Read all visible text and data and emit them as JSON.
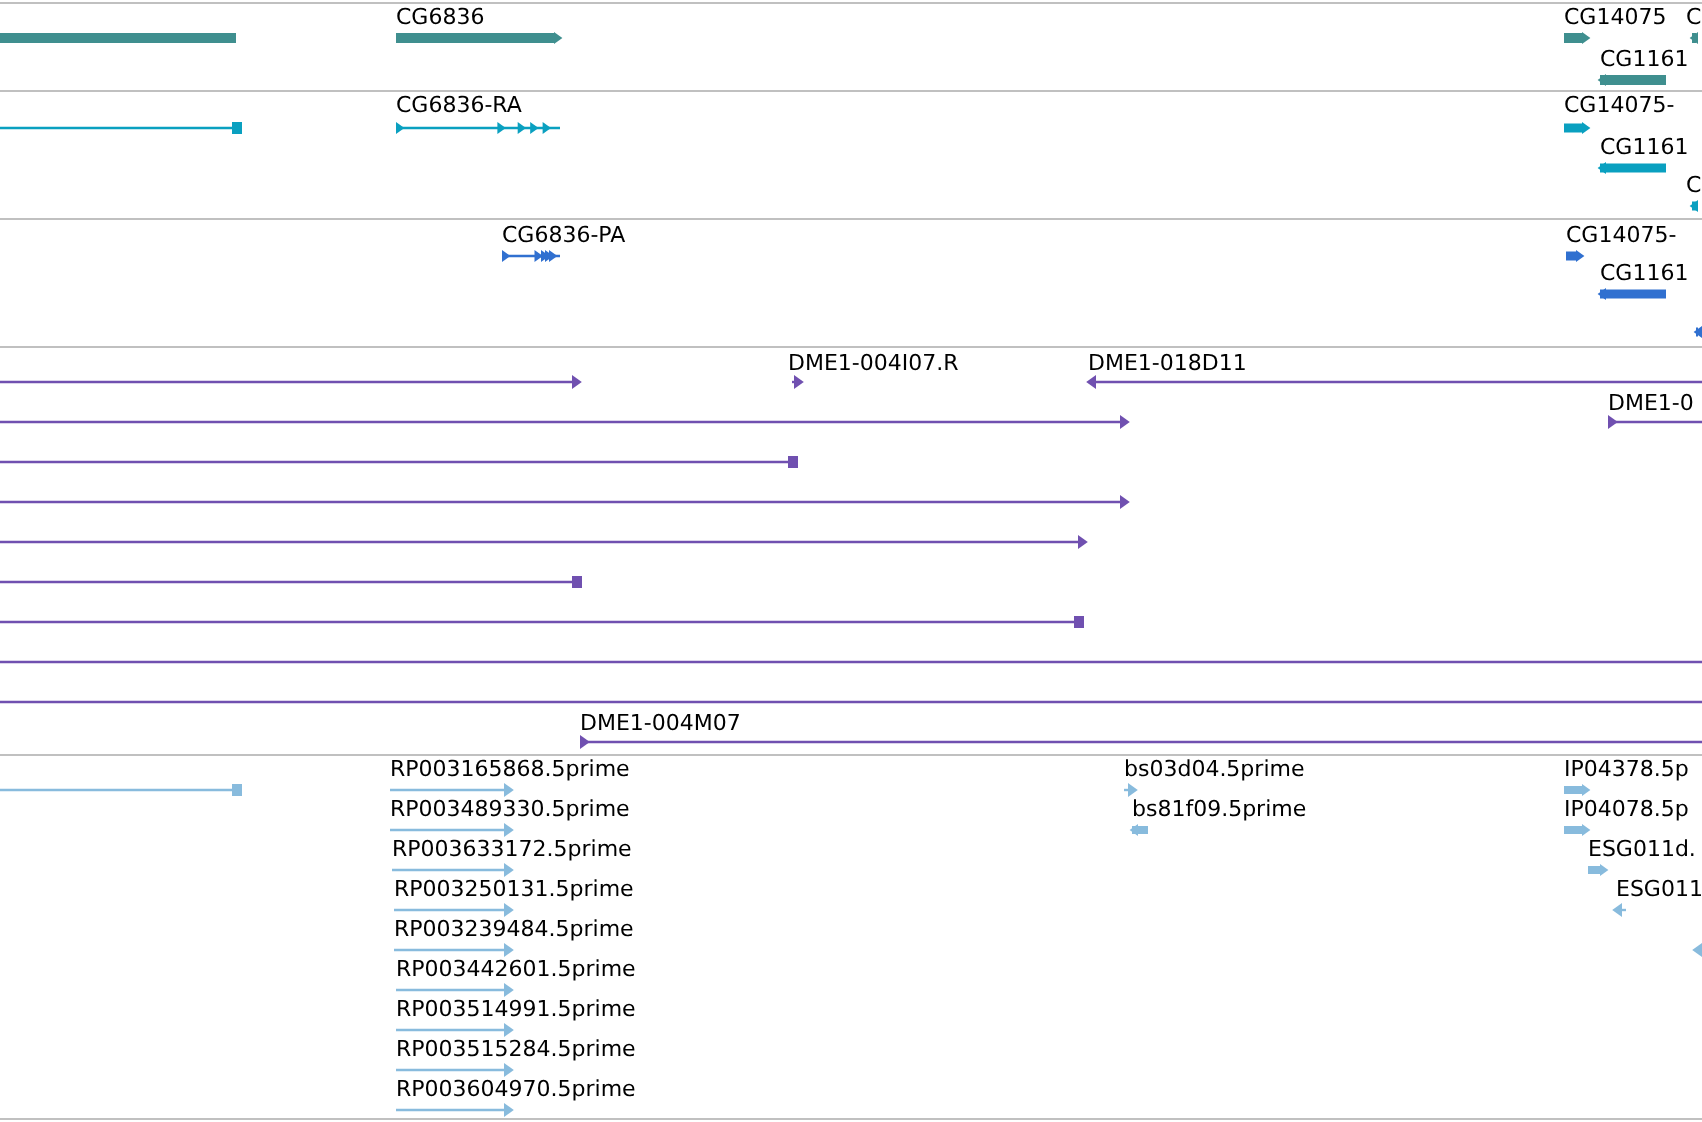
{
  "tracks": [
    {
      "kind": "gene",
      "color": "#3f8f8f",
      "features": [
        {
          "kind": "bar"
        },
        {
          "kind": "bar",
          "reverse": false,
          "label": "CG6836"
        },
        {
          "kind": "bar",
          "reverse": false,
          "label": "CG14075"
        },
        {
          "kind": "bar",
          "reverse": true,
          "label": "C"
        },
        {
          "kind": "bar",
          "reverse": true,
          "label": "CG1161"
        }
      ]
    },
    {
      "kind": "transcript",
      "color": "#0aa0c0",
      "features": [
        {
          "kind": "line",
          "reverse": true
        },
        {
          "kind": "exons",
          "reverse": false,
          "label": "CG6836-RA"
        },
        {
          "kind": "bar",
          "reverse": false,
          "label": "CG14075-"
        },
        {
          "kind": "bar",
          "reverse": true,
          "label": "CG1161"
        },
        {
          "kind": "bar",
          "reverse": true,
          "label": "C"
        }
      ]
    },
    {
      "kind": "protein",
      "color": "#3070d0",
      "features": [
        {
          "kind": "exons",
          "reverse": false,
          "label": "CG6836-PA"
        },
        {
          "kind": "bar",
          "reverse": false,
          "label": "CG14075-"
        },
        {
          "kind": "bar",
          "reverse": true,
          "label": "CG1161"
        },
        {
          "kind": "bar",
          "reverse": true
        }
      ]
    },
    {
      "kind": "clone",
      "color": "#7050b0",
      "features": [
        {
          "kind": "line",
          "reverse": false
        },
        {
          "kind": "line",
          "reverse": false,
          "label": "DME1-004I07.R"
        },
        {
          "kind": "line",
          "reverse": true,
          "label": "DME1-018D11"
        },
        {
          "kind": "line",
          "reverse": false
        },
        {
          "kind": "line",
          "reverse": false,
          "label": "DME1-0"
        },
        {
          "kind": "line",
          "reverse": true
        },
        {
          "kind": "line",
          "reverse": false
        },
        {
          "kind": "line",
          "reverse": false
        },
        {
          "kind": "line",
          "reverse": true
        },
        {
          "kind": "line",
          "reverse": true
        },
        {
          "kind": "line"
        },
        {
          "kind": "line"
        },
        {
          "kind": "line",
          "reverse": false,
          "label": "DME1-004M07"
        }
      ]
    },
    {
      "kind": "est",
      "color": "#88bbdd",
      "features": [
        {
          "kind": "line",
          "reverse": true
        },
        {
          "kind": "line",
          "reverse": false,
          "label": "RP003165868.5prime"
        },
        {
          "kind": "line",
          "reverse": false,
          "label": "bs03d04.5prime"
        },
        {
          "kind": "bar",
          "reverse": false,
          "label": "IP04378.5p"
        },
        {
          "kind": "line",
          "reverse": false,
          "label": "RP003489330.5prime"
        },
        {
          "kind": "bar",
          "reverse": true,
          "label": "bs81f09.5prime"
        },
        {
          "kind": "bar",
          "reverse": false,
          "label": "IP04078.5p"
        },
        {
          "kind": "line",
          "reverse": false,
          "label": "RP003633172.5prime"
        },
        {
          "kind": "bar",
          "reverse": false,
          "label": "ESG011d."
        },
        {
          "kind": "line",
          "reverse": false,
          "label": "RP003250131.5prime"
        },
        {
          "kind": "line",
          "reverse": true,
          "label": "ESG011"
        },
        {
          "kind": "line",
          "reverse": false,
          "label": "RP003239484.5prime"
        },
        {
          "kind": "line",
          "reverse": true
        },
        {
          "kind": "line",
          "reverse": false,
          "label": "RP003442601.5prime"
        },
        {
          "kind": "line",
          "reverse": false,
          "label": "RP003514991.5prime"
        },
        {
          "kind": "line",
          "reverse": false,
          "label": "RP003515284.5prime"
        },
        {
          "kind": "line",
          "reverse": false,
          "label": "RP003604970.5prime"
        }
      ]
    }
  ]
}
